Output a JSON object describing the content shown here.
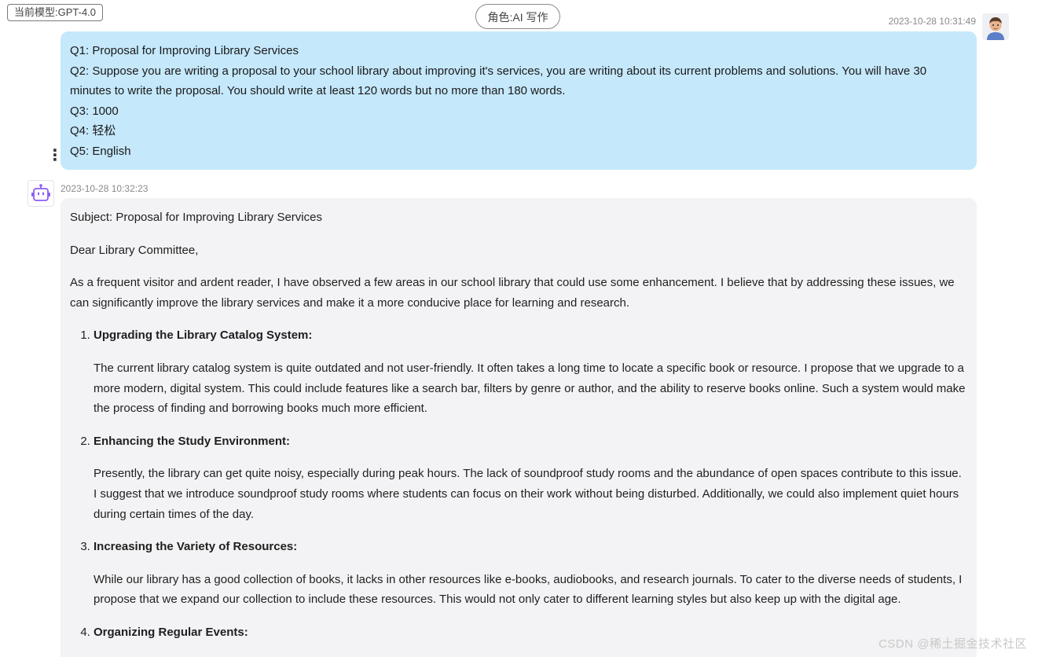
{
  "header": {
    "model_label": "当前模型:GPT-4.0",
    "role_label": "角色:AI 写作"
  },
  "user_message": {
    "timestamp": "2023-10-28 10:31:49",
    "lines": [
      "Q1:  Proposal for Improving Library Services",
      "Q2: Suppose you are writing a proposal to your school library about improving it's services, you are writing about its current problems and solutions. You will have 30 minutes to write the proposal. You should write at least 120 words but no more than 180 words.",
      "Q3: 1000",
      "Q4: 轻松",
      "Q5: English"
    ]
  },
  "more_icon": "more-vertical-icon",
  "bot_message": {
    "timestamp": "2023-10-28 10:32:23",
    "subject": "Subject: Proposal for Improving Library Services",
    "greeting": "Dear Library Committee,",
    "intro": "As a frequent visitor and ardent reader, I have observed a few areas in our school library that could use some enhancement. I believe that by addressing these issues, we can significantly improve the library services and make it a more conducive place for learning and research.",
    "items": [
      {
        "title": "Upgrading the Library Catalog System:",
        "body": "The current library catalog system is quite outdated and not user-friendly. It often takes a long time to locate a specific book or resource. I propose that we upgrade to a more modern, digital system. This could include features like a search bar, filters by genre or author, and the ability to reserve books online. Such a system would make the process of finding and borrowing books much more efficient."
      },
      {
        "title": "Enhancing the Study Environment:",
        "body": "Presently, the library can get quite noisy, especially during peak hours. The lack of soundproof study rooms and the abundance of open spaces contribute to this issue. I suggest that we introduce soundproof study rooms where students can focus on their work without being disturbed. Additionally, we could also implement quiet hours during certain times of the day."
      },
      {
        "title": "Increasing the Variety of Resources:",
        "body": "While our library has a good collection of books, it lacks in other resources like e-books, audiobooks, and research journals. To cater to the diverse needs of students, I propose that we expand our collection to include these resources. This would not only cater to different learning styles but also keep up with the digital age."
      },
      {
        "title": "Organizing Regular Events:",
        "body": ""
      }
    ]
  },
  "watermark": "CSDN @稀土掘金技术社区",
  "colors": {
    "user_bubble": "#c5e8fb",
    "bot_bubble": "#f3f3f5",
    "bot_icon": "#8b5cf6"
  }
}
